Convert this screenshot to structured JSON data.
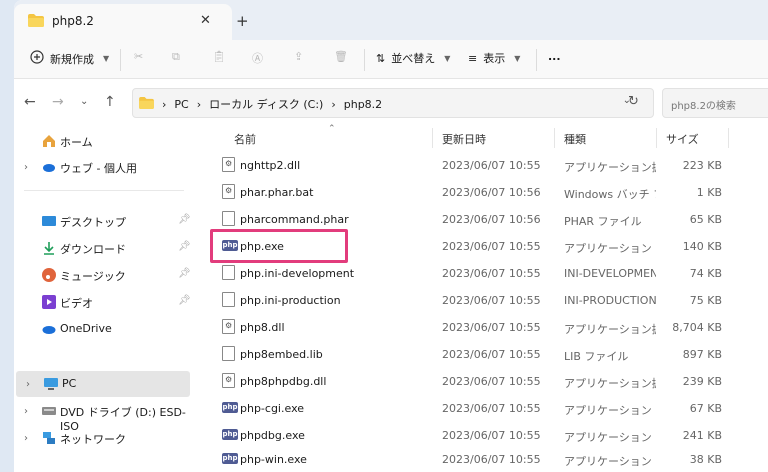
{
  "tab": {
    "title": "php8.2",
    "close": "✕",
    "newtab": "+"
  },
  "toolbar": {
    "new_label": "新規作成",
    "sort_label": "並べ替え",
    "view_label": "表示",
    "more_label": "..."
  },
  "address": {
    "crumbs": [
      "PC",
      "ローカル ディスク (C:)",
      "php8.2"
    ],
    "search_placeholder": "php8.2の検索"
  },
  "sidebar": {
    "items": [
      {
        "label": "ホーム",
        "icon": "home-icon",
        "expand": "",
        "pin": ""
      },
      {
        "label": "ウェブ - 個人用",
        "icon": "cloud-icon",
        "expand": "›",
        "pin": ""
      },
      {
        "label": "デスクトップ",
        "icon": "desktop-icon",
        "expand": "",
        "pin": "📌"
      },
      {
        "label": "ダウンロード",
        "icon": "download-icon",
        "expand": "",
        "pin": "📌"
      },
      {
        "label": "ミュージック",
        "icon": "music-icon",
        "expand": "",
        "pin": "📌"
      },
      {
        "label": "ビデオ",
        "icon": "video-icon",
        "expand": "",
        "pin": "📌"
      },
      {
        "label": "OneDrive",
        "icon": "onedrive-icon",
        "expand": "",
        "pin": ""
      },
      {
        "label": "PC",
        "icon": "pc-icon",
        "expand": "›",
        "pin": ""
      },
      {
        "label": "DVD ドライブ (D:) ESD-ISO",
        "icon": "dvd-icon",
        "expand": "›",
        "pin": ""
      },
      {
        "label": "ネットワーク",
        "icon": "network-icon",
        "expand": "›",
        "pin": ""
      }
    ]
  },
  "columns": {
    "name": "名前",
    "date": "更新日時",
    "type": "種類",
    "size": "サイズ"
  },
  "files": [
    {
      "name": "nghttp2.dll",
      "date": "2023/06/07 10:55",
      "type": "アプリケーション拡張",
      "size": "223 KB",
      "icon": "dll"
    },
    {
      "name": "phar.phar.bat",
      "date": "2023/06/07 10:56",
      "type": "Windows バッチ ファ...",
      "size": "1 KB",
      "icon": "bat"
    },
    {
      "name": "pharcommand.phar",
      "date": "2023/06/07 10:56",
      "type": "PHAR ファイル",
      "size": "65 KB",
      "icon": "file"
    },
    {
      "name": "php.exe",
      "date": "2023/06/07 10:55",
      "type": "アプリケーション",
      "size": "140 KB",
      "icon": "php"
    },
    {
      "name": "php.ini-development",
      "date": "2023/06/07 10:55",
      "type": "INI-DEVELOPMEN...",
      "size": "74 KB",
      "icon": "file"
    },
    {
      "name": "php.ini-production",
      "date": "2023/06/07 10:55",
      "type": "INI-PRODUCTION ...",
      "size": "75 KB",
      "icon": "file"
    },
    {
      "name": "php8.dll",
      "date": "2023/06/07 10:55",
      "type": "アプリケーション拡張",
      "size": "8,704 KB",
      "icon": "dll"
    },
    {
      "name": "php8embed.lib",
      "date": "2023/06/07 10:55",
      "type": "LIB ファイル",
      "size": "897 KB",
      "icon": "file"
    },
    {
      "name": "php8phpdbg.dll",
      "date": "2023/06/07 10:55",
      "type": "アプリケーション拡張",
      "size": "239 KB",
      "icon": "dll"
    },
    {
      "name": "php-cgi.exe",
      "date": "2023/06/07 10:55",
      "type": "アプリケーション",
      "size": "67 KB",
      "icon": "php"
    },
    {
      "name": "phpdbg.exe",
      "date": "2023/06/07 10:55",
      "type": "アプリケーション",
      "size": "241 KB",
      "icon": "php"
    },
    {
      "name": "php-win.exe",
      "date": "2023/06/07 10:55",
      "type": "アプリケーション",
      "size": "38 KB",
      "icon": "php"
    }
  ],
  "colors": {
    "highlight": "#e23c7c",
    "php_icon": "#4f5b93",
    "folder": "#f4c542"
  }
}
